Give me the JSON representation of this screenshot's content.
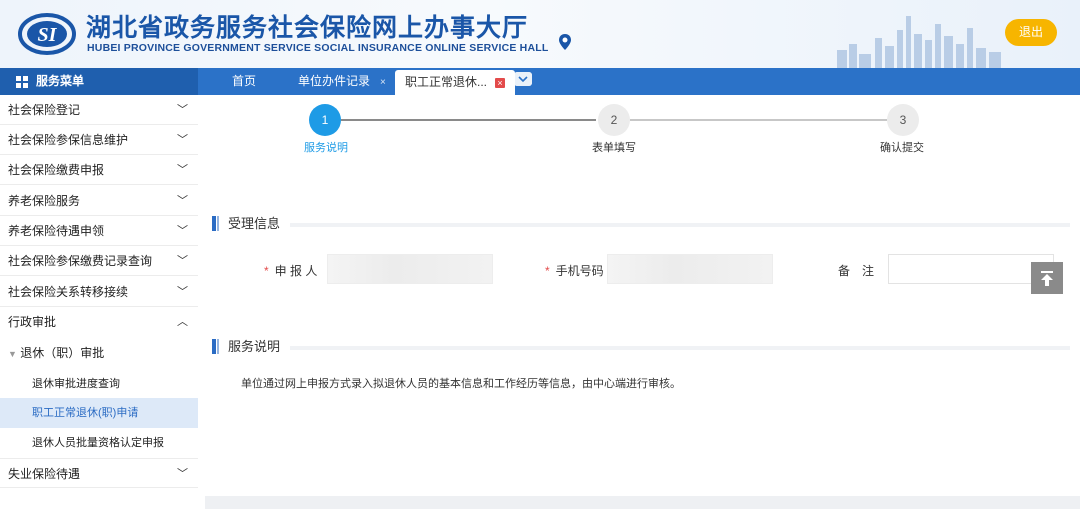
{
  "header": {
    "logo_text": "SI",
    "title_cn": "湖北省政务服务社会保险网上办事大厅",
    "title_en": "HUBEI PROVINCE GOVERNMENT SERVICE SOCIAL INSURANCE ONLINE SERVICE HALL",
    "logout_label": "退出"
  },
  "nav": {
    "menu_title": "服务菜单",
    "tabs": [
      {
        "label": "首页",
        "closable": false
      },
      {
        "label": "单位办件记录",
        "closable": true
      },
      {
        "label": "职工正常退休...",
        "closable": true,
        "active": true
      }
    ]
  },
  "sidebar": {
    "items": [
      {
        "label": "社会保险登记",
        "chevron": "chevron-down"
      },
      {
        "label": "社会保险参保信息维护",
        "chevron": "chevron-down"
      },
      {
        "label": "社会保险缴费申报",
        "chevron": "chevron-down"
      },
      {
        "label": "养老保险服务",
        "chevron": "chevron-down"
      },
      {
        "label": "养老保险待遇申领",
        "chevron": "chevron-down"
      },
      {
        "label": "社会保险参保缴费记录查询",
        "chevron": "chevron-down"
      },
      {
        "label": "社会保险关系转移接续",
        "chevron": "chevron-down"
      },
      {
        "label": "行政审批",
        "chevron": "chevron-up"
      }
    ],
    "group": {
      "label": "退休（职）审批"
    },
    "sub_items": [
      {
        "label": "退休审批进度查询",
        "selected": false
      },
      {
        "label": "职工正常退休(职)申请",
        "selected": true
      },
      {
        "label": "退休人员批量资格认定申报",
        "selected": false
      }
    ],
    "last_item": {
      "label": "失业保险待遇",
      "chevron": "chevron-down"
    }
  },
  "steps": [
    {
      "number": "1",
      "label": "服务说明",
      "state": "active"
    },
    {
      "number": "2",
      "label": "表单填写",
      "state": "pending"
    },
    {
      "number": "3",
      "label": "确认提交",
      "state": "pending"
    }
  ],
  "form": {
    "section_title": "受理信息",
    "fields": [
      {
        "label": "申 报 人",
        "required": true,
        "value": ""
      },
      {
        "label": "手机号码",
        "required": true,
        "value": ""
      },
      {
        "label": "备　注",
        "required": false,
        "value": ""
      }
    ]
  },
  "service": {
    "section_title": "服务说明",
    "description": "单位通过网上申报方式录入拟退休人员的基本信息和工作经历等信息，由中心端进行审核。"
  },
  "colors": {
    "primary": "#2b72c8",
    "step_active": "#1e9be6",
    "logout": "#f7b500",
    "selected_bg": "#dde9f8"
  }
}
